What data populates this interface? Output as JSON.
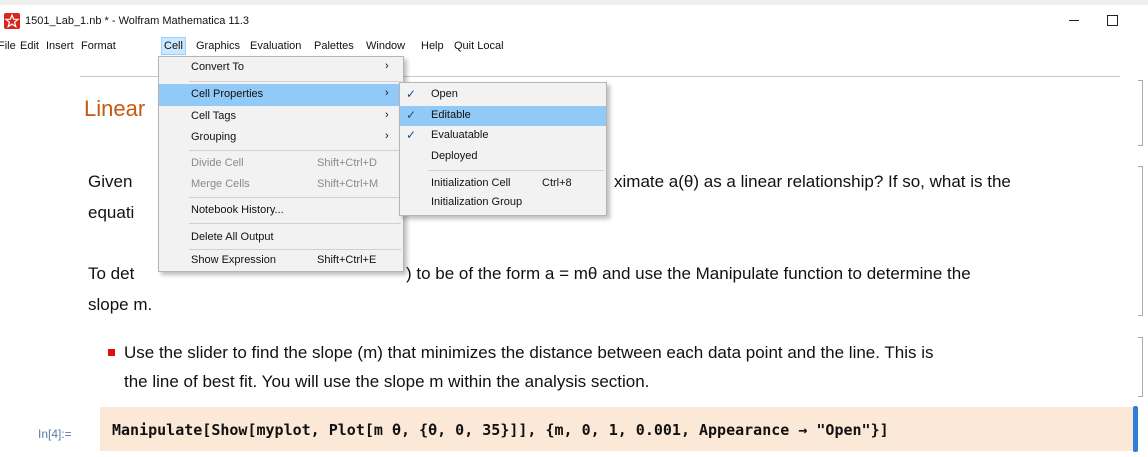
{
  "window": {
    "title": "1501_Lab_1.nb * - Wolfram Mathematica 11.3"
  },
  "menubar": {
    "items": [
      "File",
      "Edit",
      "Insert",
      "Format",
      "Cell",
      "Graphics",
      "Evaluation",
      "Palettes",
      "Window",
      "Help",
      "Quit Local"
    ],
    "active": "Cell"
  },
  "cell_menu": {
    "convert_to": "Convert To",
    "cell_properties": "Cell Properties",
    "cell_tags": "Cell Tags",
    "grouping": "Grouping",
    "divide_cell": "Divide Cell",
    "divide_cell_shortcut": "Shift+Ctrl+D",
    "merge_cells": "Merge Cells",
    "merge_cells_shortcut": "Shift+Ctrl+M",
    "notebook_history": "Notebook History...",
    "delete_all_output": "Delete All Output",
    "show_expression": "Show Expression",
    "show_expression_shortcut": "Shift+Ctrl+E"
  },
  "cell_properties_menu": {
    "open": "Open",
    "editable": "Editable",
    "evaluatable": "Evaluatable",
    "deployed": "Deployed",
    "initialization_cell": "Initialization Cell",
    "initialization_cell_shortcut": "Ctrl+8",
    "initialization_group": "Initialization Group",
    "checked": [
      "Open",
      "Editable",
      "Evaluatable"
    ]
  },
  "notebook": {
    "section_title": "Linear",
    "para1_line1_start": "Given",
    "para1_line1_end": "ximate a(θ) as a linear relationship? If so, what is the",
    "para1_line2": "equati",
    "para2_line1_start": "To det",
    "para2_line1_end": ") to be of the form a = mθ and use the Manipulate function to determine the",
    "para2_line2": "slope m.",
    "bullet_line1": "Use the slider to find the slope (m) that minimizes the distance between each data point and the line. This is",
    "bullet_line2": "the line of best fit. You will use the slope m within the analysis section.",
    "input_label": "In[4]:=",
    "input_code": "Manipulate[Show[myplot, Plot[m θ, {θ, 0, 35}]], {m, 0, 1, 0.001, Appearance → \"Open\"}]"
  },
  "colors": {
    "accent": "#c55a11",
    "menu_highlight": "#91c9f7",
    "input_background": "#fbe8d6",
    "selection_bar": "#2f7fd8"
  }
}
